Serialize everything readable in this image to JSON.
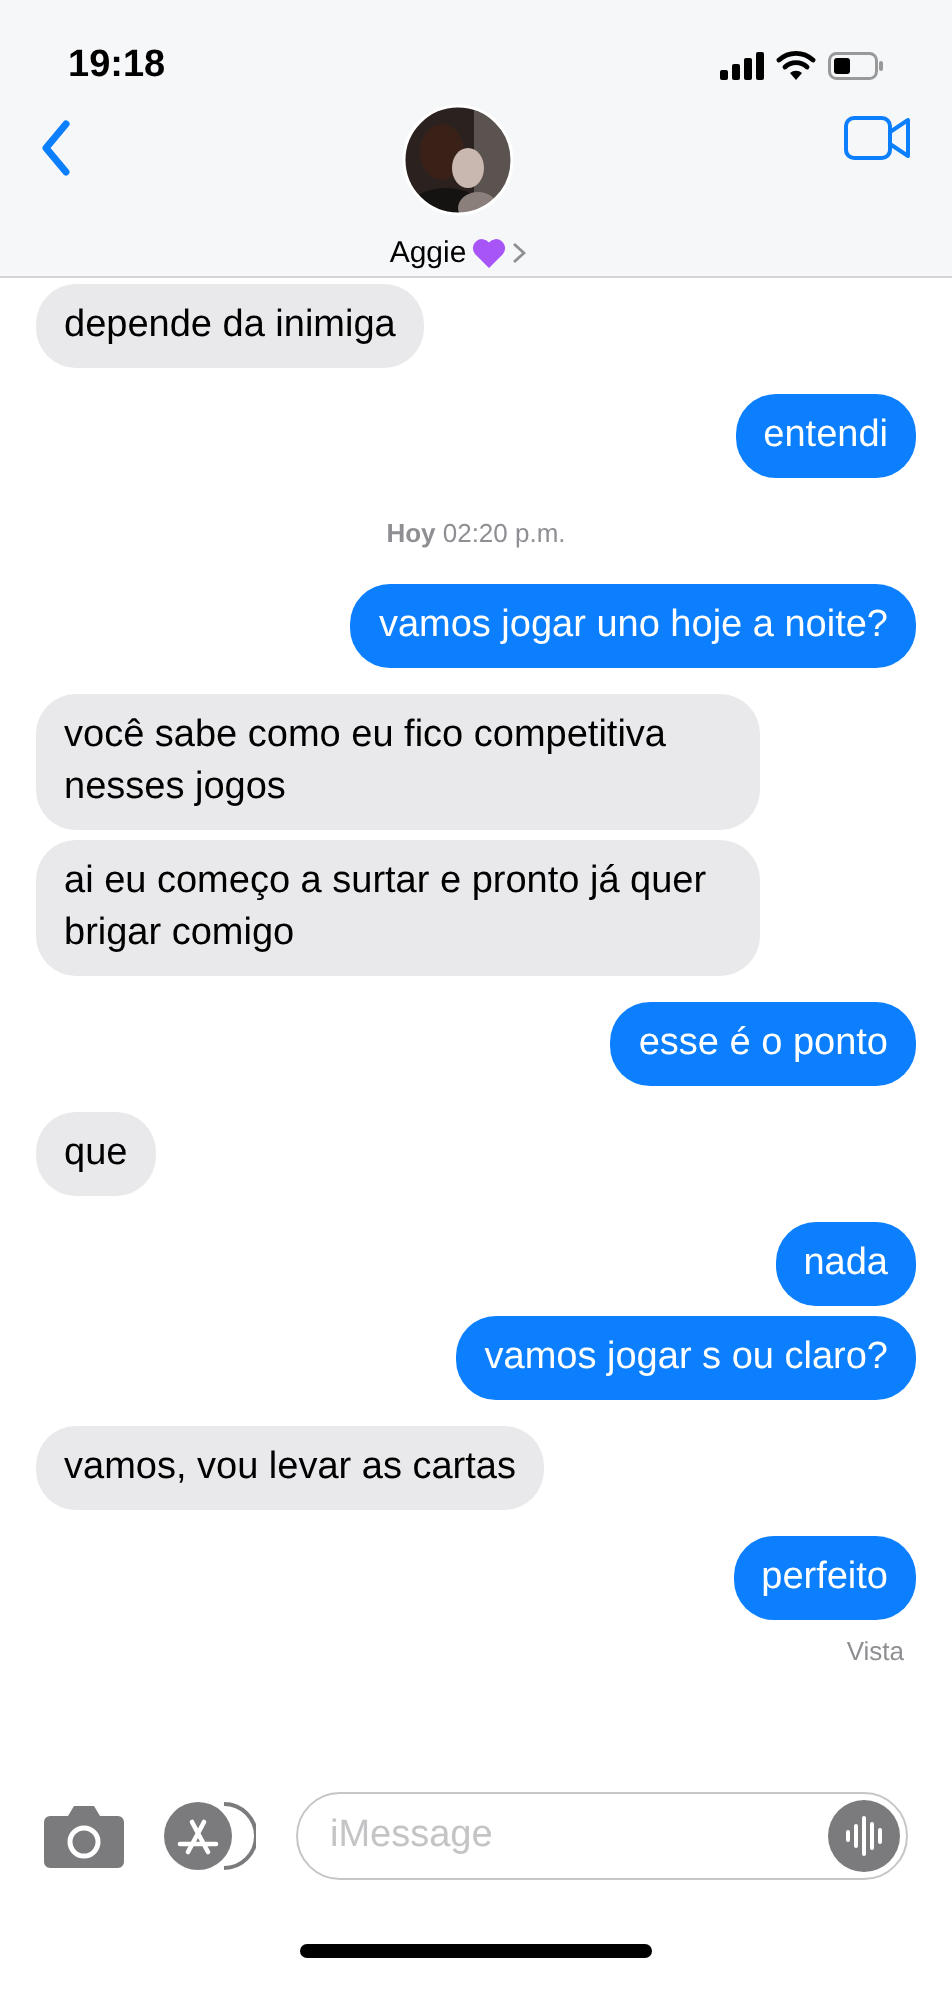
{
  "status_bar": {
    "time": "19:18"
  },
  "header": {
    "contact_name": "Aggie"
  },
  "messages": [
    {
      "kind": "in",
      "text": "depende da inimiga"
    },
    {
      "kind": "out",
      "text": "entendi"
    },
    {
      "kind": "timestamp",
      "text": "**Hoy** 02:20 p.m."
    },
    {
      "kind": "out",
      "text": "vamos jogar uno hoje a noite?"
    },
    {
      "kind": "in",
      "text": "você sabe como eu fico competitiva nesses jogos"
    },
    {
      "kind": "in",
      "text": "ai eu começo a surtar e pronto já quer brigar comigo"
    },
    {
      "kind": "out",
      "text": "esse é o ponto"
    },
    {
      "kind": "in",
      "text": "que"
    },
    {
      "kind": "out",
      "text": "nada"
    },
    {
      "kind": "out",
      "text": "vamos jogar s ou claro?"
    },
    {
      "kind": "in",
      "text": "vamos, vou levar as cartas"
    },
    {
      "kind": "out",
      "text": "perfeito"
    },
    {
      "kind": "receipt",
      "text": "Vista"
    }
  ],
  "composer": {
    "placeholder": "iMessage"
  }
}
